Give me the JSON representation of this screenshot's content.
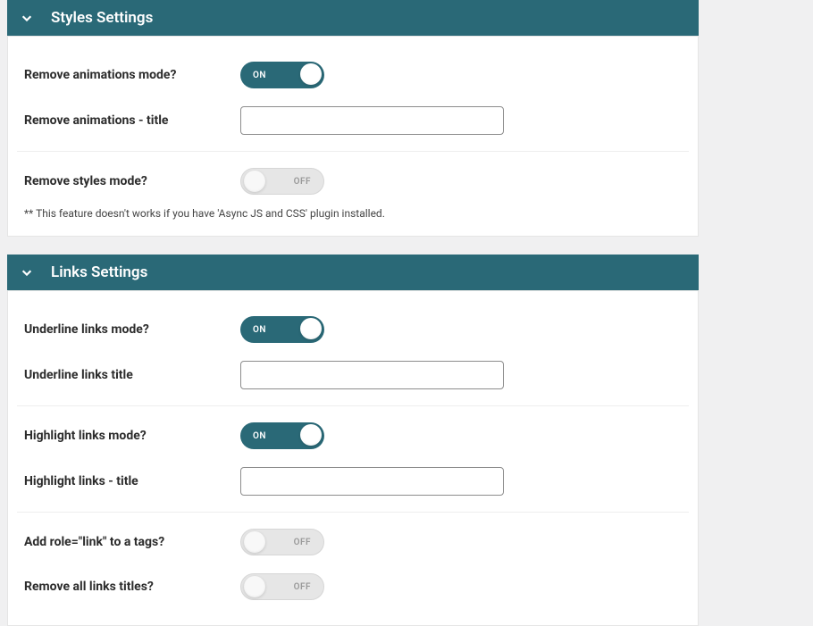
{
  "sections": {
    "styles": {
      "title": "Styles Settings",
      "remove_animations_label": "Remove animations mode?",
      "remove_animations_on": true,
      "remove_animations_title_label": "Remove animations - title",
      "remove_animations_title_value": "",
      "remove_styles_label": "Remove styles mode?",
      "remove_styles_on": false,
      "note": "** This feature doesn't works if you have 'Async JS and CSS' plugin installed."
    },
    "links": {
      "title": "Links Settings",
      "underline_links_label": "Underline links mode?",
      "underline_links_on": true,
      "underline_links_title_label": "Underline links title",
      "underline_links_title_value": "",
      "highlight_links_label": "Highlight links mode?",
      "highlight_links_on": true,
      "highlight_links_title_label": "Highlight links - title",
      "highlight_links_title_value": "",
      "add_role_label": "Add role=\"link\" to a tags?",
      "add_role_on": false,
      "remove_titles_label": "Remove all links titles?",
      "remove_titles_on": false
    }
  },
  "toggle_labels": {
    "on": "ON",
    "off": "OFF"
  }
}
